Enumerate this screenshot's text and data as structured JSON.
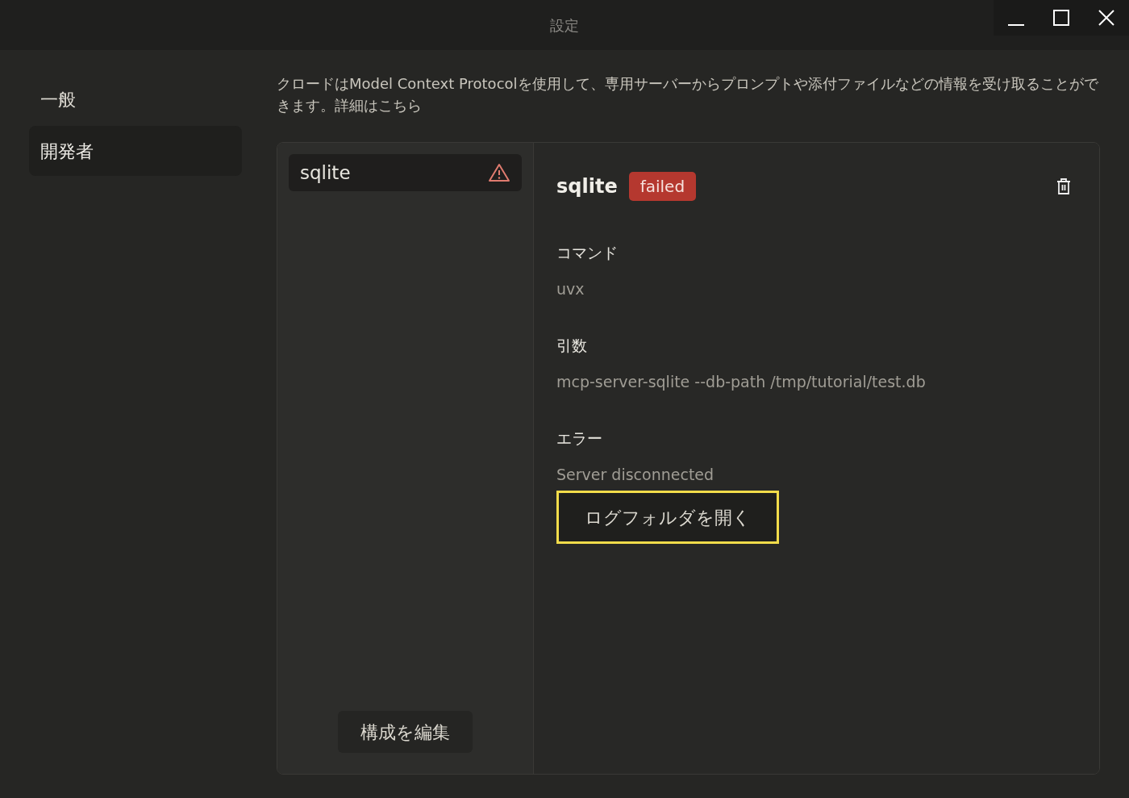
{
  "window": {
    "title": "設定"
  },
  "sidebar": {
    "items": [
      {
        "label": "一般",
        "selected": false
      },
      {
        "label": "開発者",
        "selected": true
      }
    ]
  },
  "description": "クロードはModel Context Protocolを使用して、専用サーバーからプロンプトや添付ファイルなどの情報を受け取ることができます。詳細はこちら",
  "servers": [
    {
      "name": "sqlite",
      "selected": true,
      "warning": true
    }
  ],
  "edit_button": "構成を編集",
  "detail": {
    "name": "sqlite",
    "status": "failed",
    "fields": [
      {
        "label": "コマンド",
        "value": "uvx"
      },
      {
        "label": "引数",
        "value": "mcp-server-sqlite --db-path /tmp/tutorial/test.db"
      },
      {
        "label": "エラー",
        "value": "Server disconnected"
      }
    ],
    "action_button": "ログフォルダを開く",
    "action_highlighted": true
  }
}
